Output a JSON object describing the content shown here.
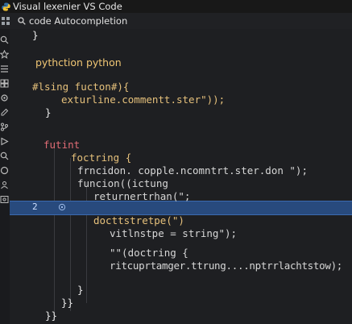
{
  "window": {
    "title": "Visual lexenier  VS Code"
  },
  "search": {
    "query": "code Autocompletion"
  },
  "activity_bar": {
    "icons": [
      "search-icon",
      "star-icon",
      "list-icon",
      "extensions-icon",
      "settings-icon",
      "edit-icon",
      "branch-icon",
      "debug-icon",
      "search-icon",
      "source-control-icon",
      "account-icon",
      "image-icon"
    ]
  },
  "editor": {
    "highlight_line_number": "2",
    "lines": [
      "}",
      "pythction python",
      "#lsing fucton#){",
      "exturline.commentt.ster\"));",
      "}",
      "futint",
      "foctring  {",
      "frncidon. copple.ncomntrt.ster.don \");",
      "funcion((ictung",
      "returnertrhan(\";",
      "docttstretpe(\")",
      "vitlnstpe = string\");",
      "\"\"(doctring {",
      "ritcuprtamger.ttrung....nptrrlachtstow);",
      "}",
      "}}",
      "}}"
    ]
  }
}
